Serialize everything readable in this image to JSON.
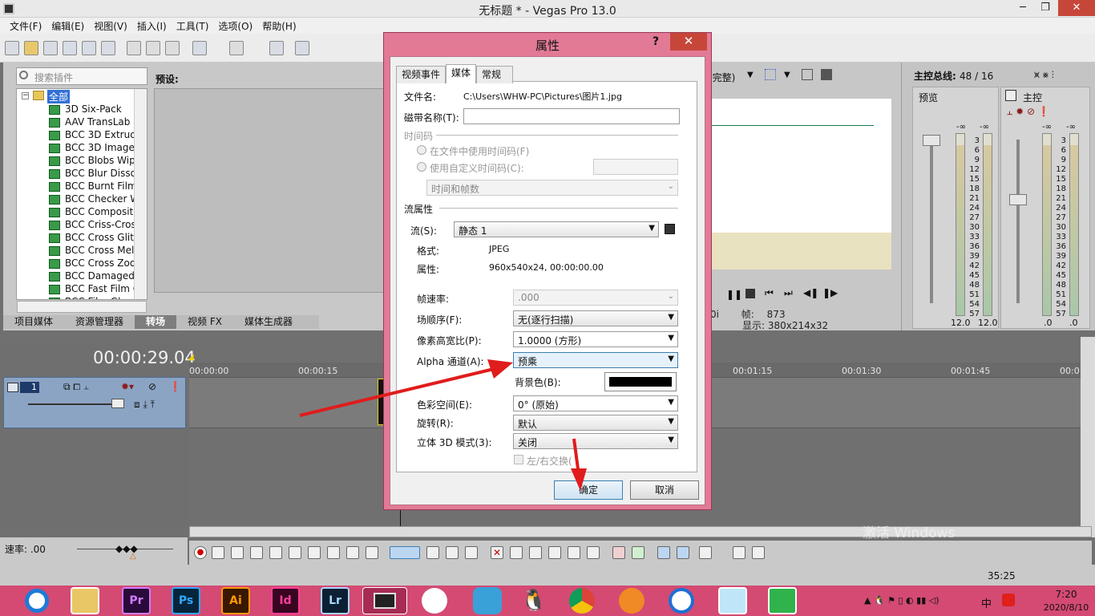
{
  "window": {
    "title": "无标题 * - Vegas Pro 13.0",
    "min": "─",
    "max": "❐",
    "close": "✕"
  },
  "menu": [
    "文件(F)",
    "编辑(E)",
    "视图(V)",
    "插入(I)",
    "工具(T)",
    "选项(O)",
    "帮助(H)"
  ],
  "plugins": {
    "search_placeholder": "搜索插件",
    "root": "全部",
    "items": [
      "3D Six-Pack",
      "AAV TransLab",
      "BCC 3D Extrude",
      "BCC 3D Image S",
      "BCC Blobs Wipe",
      "BCC Blur Dissolv",
      "BCC Burnt Film",
      "BCC Checker Wi",
      "BCC Composite",
      "BCC Criss-Cross",
      "BCC Cross Glitch",
      "BCC Cross Melt",
      "BCC Cross Zoom",
      "BCC Damaged T",
      "BCC Fast Film G",
      "BCC Film Glow"
    ]
  },
  "preview_label": "预设:",
  "bottom_tabs": [
    "项目媒体",
    "资源管理器",
    "转场",
    "视频 FX",
    "媒体生成器"
  ],
  "active_tab_index": 2,
  "video_preview": {
    "mode": "(完整)",
    "frame_label": "帧:",
    "frame_value": "873",
    "display_label": "显示:",
    "display_value": "380x214x32",
    "partial": "0i"
  },
  "master": {
    "title": "主控总线:",
    "counts": "48 / 16",
    "preview": "预览",
    "main": "主控",
    "db_ticks": [
      "-∞",
      "3",
      "6",
      "9",
      "12",
      "15",
      "18",
      "21",
      "24",
      "27",
      "30",
      "33",
      "36",
      "39",
      "42",
      "45",
      "48",
      "51",
      "54",
      "57"
    ],
    "left_values": [
      "12.0",
      "12.0"
    ],
    "right_values": [
      ".0",
      ".0"
    ],
    "neg_inf": "-∞"
  },
  "timeline": {
    "time": "00:00:29.04",
    "track_number": "1",
    "ruler": [
      "00:00:00",
      "00:00:15",
      "00:01:15",
      "00:01:30",
      "00:01:45",
      "00:0"
    ],
    "rate_label": "速率: .00"
  },
  "status": {
    "record_time": "35:25",
    "watermark": "激活 Windows"
  },
  "taskbar": {
    "apps": [
      "Pr",
      "Ps",
      "Ai",
      "Id",
      "Lr"
    ],
    "ime": "中",
    "clock_time": "7:20",
    "clock_date": "2020/8/10"
  },
  "dialog": {
    "title": "属性",
    "help": "?",
    "close": "✕",
    "tabs": [
      "视频事件",
      "媒体",
      "常规"
    ],
    "active_tab_index": 1,
    "file_name_label": "文件名:",
    "file_name": "C:\\Users\\WHW-PC\\Pictures\\图片1.jpg",
    "tape_name_label": "磁带名称(T):",
    "tape_name": "",
    "timecode_header": "时间码",
    "timecode_in_file": "在文件中使用时间码(F)",
    "timecode_custom": "使用自定义时间码(C):",
    "timecode_format": "时间和帧数",
    "stream_props_header": "流属性",
    "stream_label": "流(S):",
    "stream_value": "静态 1",
    "format_label": "格式:",
    "format_value": "JPEG",
    "attributes_label": "属性:",
    "attributes_value": "960x540x24, 00:00:00.00",
    "frame_rate_label": "帧速率:",
    "frame_rate_value": ".000",
    "field_order_label": "场顺序(F):",
    "field_order_value": "无(逐行扫描)",
    "pixel_aspect_label": "像素高宽比(P):",
    "pixel_aspect_value": "1.0000 (方形)",
    "alpha_label": "Alpha 通道(A):",
    "alpha_value": "预乘",
    "bg_color_label": "背景色(B):",
    "bg_color": "#000000",
    "color_space_label": "色彩空间(E):",
    "color_space_value": "0° (原始)",
    "rotation_label": "旋转(R):",
    "rotation_value": "默认",
    "stereo_label": "立体 3D 模式(3):",
    "stereo_value": "关闭",
    "swap_lr_label": "左/右交换(",
    "ok": "确定",
    "cancel": "取消"
  },
  "colors": {
    "taskbar": "#d44a73",
    "dialog_frame": "#e27a96",
    "arrow": "#e01c1c",
    "track": "#8ca4c4"
  }
}
